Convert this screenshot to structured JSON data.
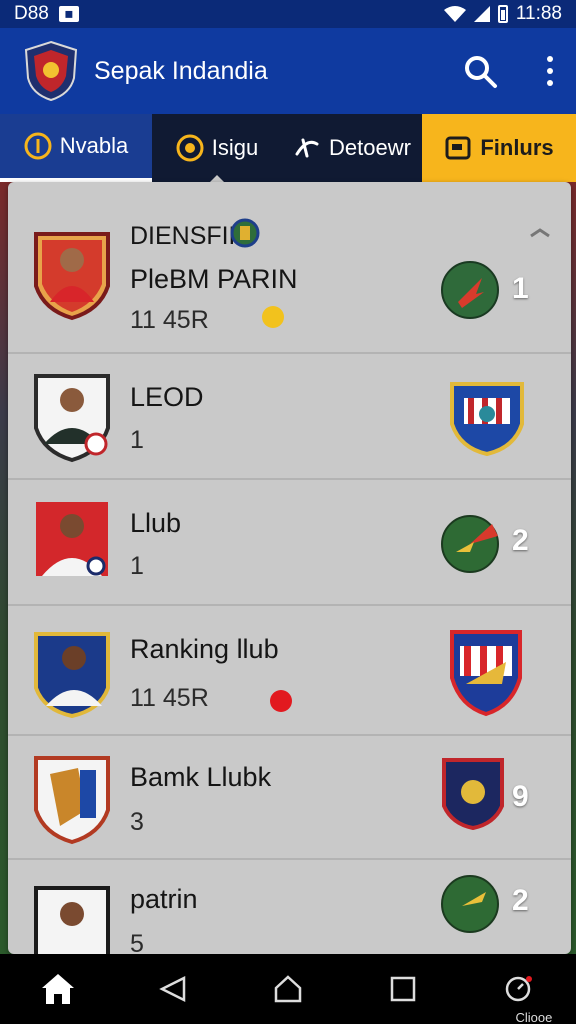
{
  "status_bar": {
    "time_left": "D88",
    "time_right": "11:88"
  },
  "app": {
    "title": "Sepak Indandia"
  },
  "tabs": [
    {
      "label": "Nvabla"
    },
    {
      "label": "Isigu"
    },
    {
      "label": "Detoewr"
    },
    {
      "label": "Finlurs"
    }
  ],
  "rows": [
    {
      "title": "DIENSFIR",
      "name": "PleBM PARIN",
      "value": "11 45R",
      "rank": "1"
    },
    {
      "name": "LEOD",
      "value": "1",
      "rank": ""
    },
    {
      "name": "Llub",
      "value": "1",
      "rank": "2"
    },
    {
      "name": "Ranking llub",
      "value": "11 45R",
      "rank": ""
    },
    {
      "name": "Bamk Llubk",
      "value": "3",
      "rank": "9"
    },
    {
      "name": "patrin",
      "value": "5",
      "rank": "2"
    }
  ],
  "nav": {
    "extra_label": "Cliooe"
  },
  "colors": {
    "appbar": "#0f3aa0",
    "active_tab": "#f7b51c",
    "panel": "#c9c9c9"
  }
}
